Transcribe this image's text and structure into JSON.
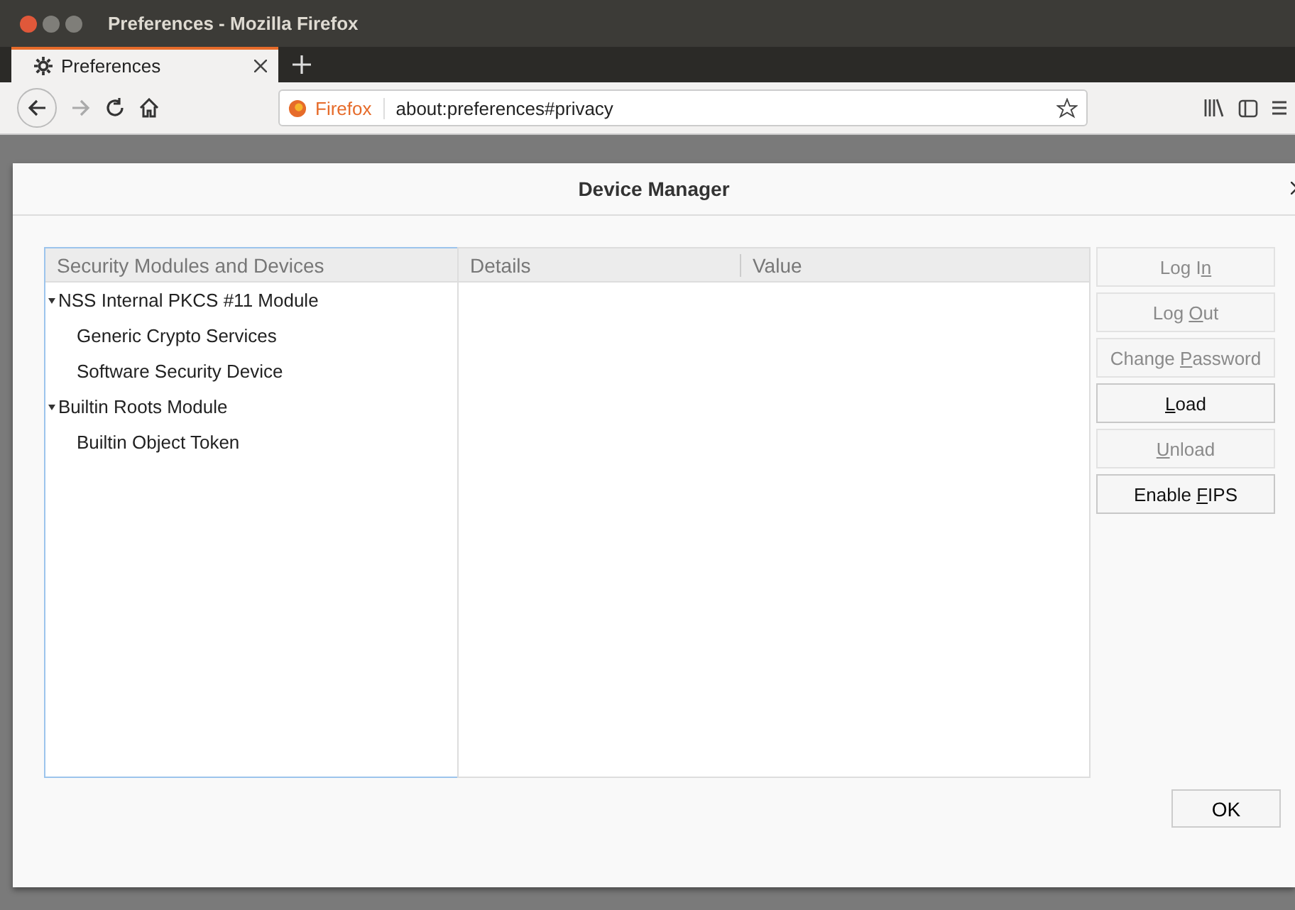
{
  "window": {
    "title": "Preferences - Mozilla Firefox"
  },
  "tabs": [
    {
      "label": "Preferences",
      "selected": true
    }
  ],
  "address_bar": {
    "identity": "Firefox",
    "url": "about:preferences#privacy"
  },
  "dialog": {
    "title": "Device Manager",
    "tree": {
      "header": "Security Modules and Devices",
      "items": [
        {
          "label": "NSS Internal PKCS #11 Module",
          "expanded": true,
          "children": [
            {
              "label": "Generic Crypto Services"
            },
            {
              "label": "Software Security Device"
            }
          ]
        },
        {
          "label": "Builtin Roots Module",
          "expanded": true,
          "children": [
            {
              "label": "Builtin Object Token"
            }
          ]
        }
      ]
    },
    "details": {
      "columns": [
        "Details",
        "Value"
      ]
    },
    "buttons": [
      {
        "before": "Log I",
        "key": "n",
        "disabled": true
      },
      {
        "before": "Log ",
        "key": "O",
        "after": "ut",
        "disabled": true
      },
      {
        "before": "Change ",
        "key": "P",
        "after": "assword",
        "disabled": true
      },
      {
        "key": "L",
        "after": "oad",
        "disabled": false
      },
      {
        "key": "U",
        "after": "nload",
        "disabled": true
      },
      {
        "before": "Enable ",
        "key": "F",
        "after": "IPS",
        "disabled": false
      }
    ],
    "ok": "OK"
  }
}
